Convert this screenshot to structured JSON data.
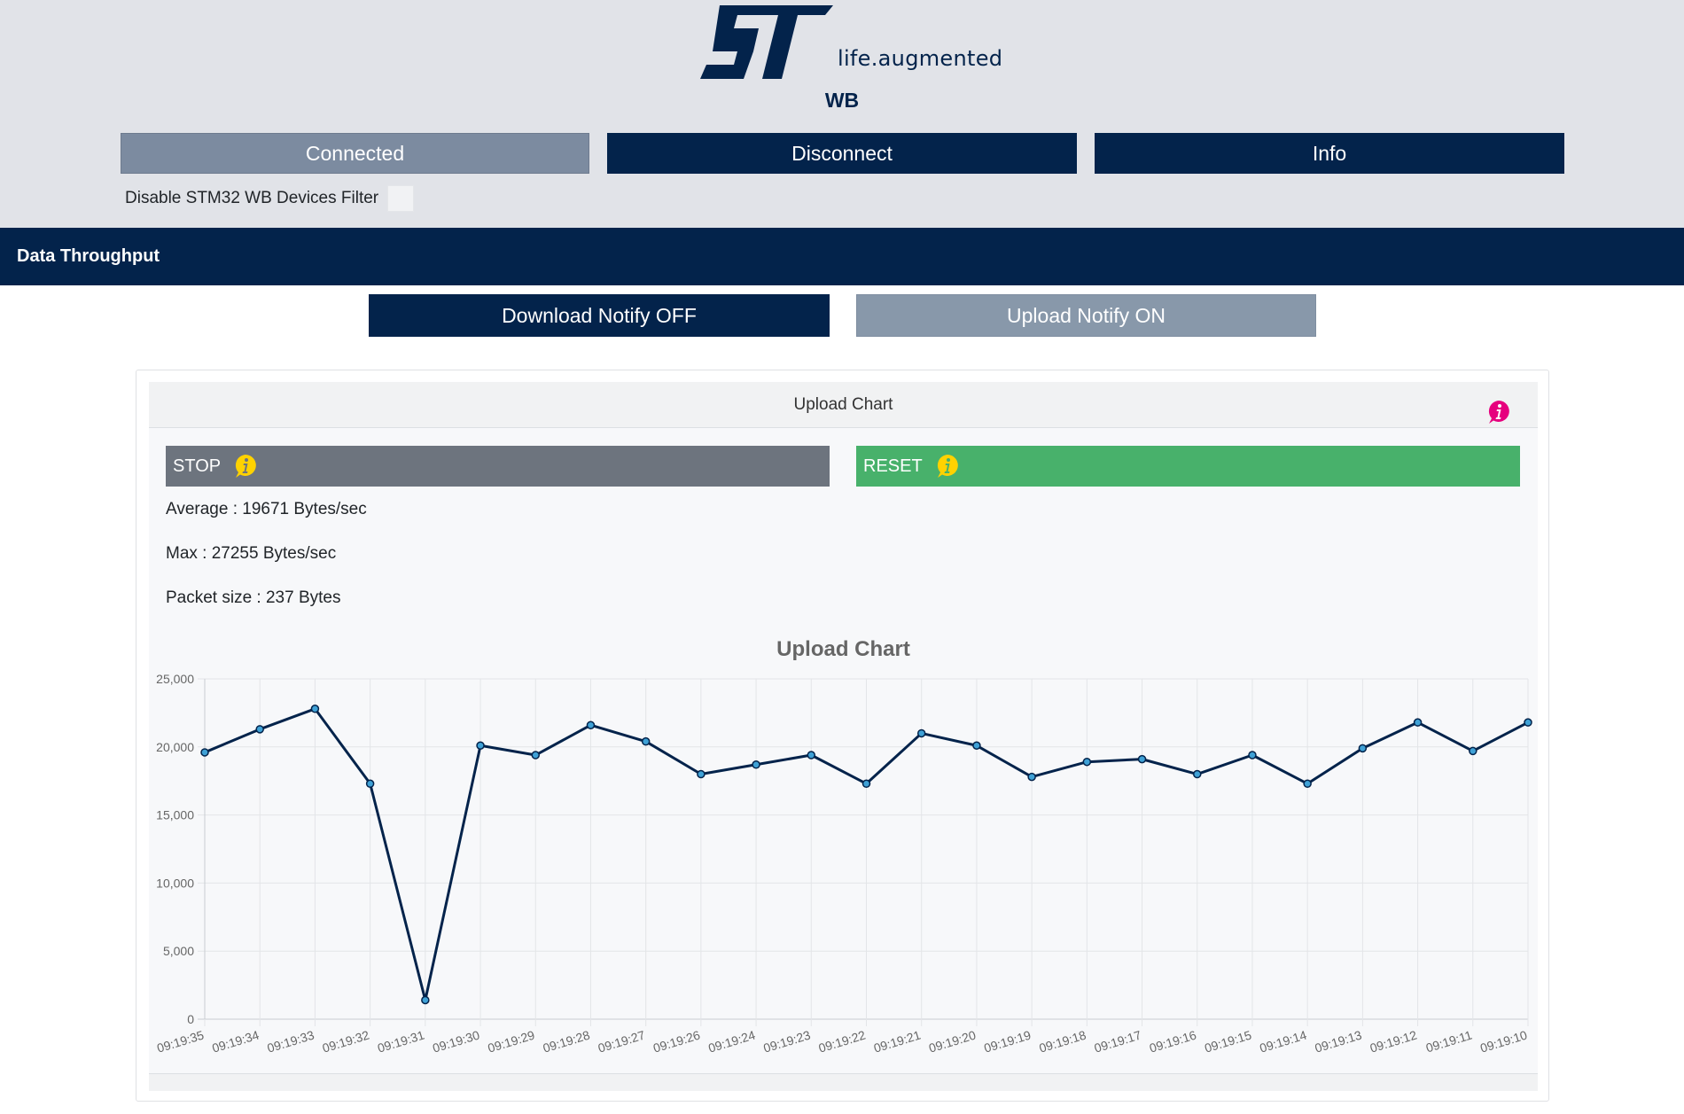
{
  "header": {
    "logo_text": "life.augmented",
    "product": "WB",
    "connected_label": "Connected",
    "disconnect_label": "Disconnect",
    "info_label": "Info",
    "filter_label": "Disable STM32 WB Devices Filter"
  },
  "section": {
    "title": "Data Throughput",
    "download_label": "Download Notify OFF",
    "upload_label": "Upload Notify ON"
  },
  "card": {
    "header": "Upload Chart",
    "stop_label": "STOP",
    "reset_label": "RESET",
    "average": "Average : 19671 Bytes/sec",
    "max": "Max : 27255 Bytes/sec",
    "packet_size": "Packet size : 237 Bytes"
  },
  "colors": {
    "brand_navy": "#03234b",
    "connected_gray": "#7c8ba0",
    "stop_gray": "#6d747e",
    "reset_green": "#48b16b",
    "info_pink": "#e6007e",
    "info_yellow": "#ffd200",
    "point_fill": "#3fa1d6"
  },
  "chart_data": {
    "type": "line",
    "title": "Upload Chart",
    "categories": [
      "09:19:35",
      "09:19:34",
      "09:19:33",
      "09:19:32",
      "09:19:31",
      "09:19:30",
      "09:19:29",
      "09:19:28",
      "09:19:27",
      "09:19:26",
      "09:19:24",
      "09:19:23",
      "09:19:22",
      "09:19:21",
      "09:19:20",
      "09:19:19",
      "09:19:18",
      "09:19:17",
      "09:19:16",
      "09:19:15",
      "09:19:14",
      "09:19:13",
      "09:19:12",
      "09:19:11",
      "09:19:10"
    ],
    "values": [
      19600,
      21300,
      22800,
      17300,
      1400,
      20100,
      19400,
      21600,
      20400,
      18000,
      18700,
      19400,
      17300,
      21000,
      20100,
      17800,
      18900,
      19100,
      18000,
      19400,
      17300,
      19900,
      21800,
      19700,
      21800
    ],
    "ylim": [
      0,
      25000
    ],
    "yticks": [
      0,
      5000,
      10000,
      15000,
      20000,
      25000
    ],
    "ytick_labels": [
      "0",
      "5,000",
      "10,000",
      "15,000",
      "20,000",
      "25,000"
    ],
    "grid": true,
    "legend": "none"
  }
}
